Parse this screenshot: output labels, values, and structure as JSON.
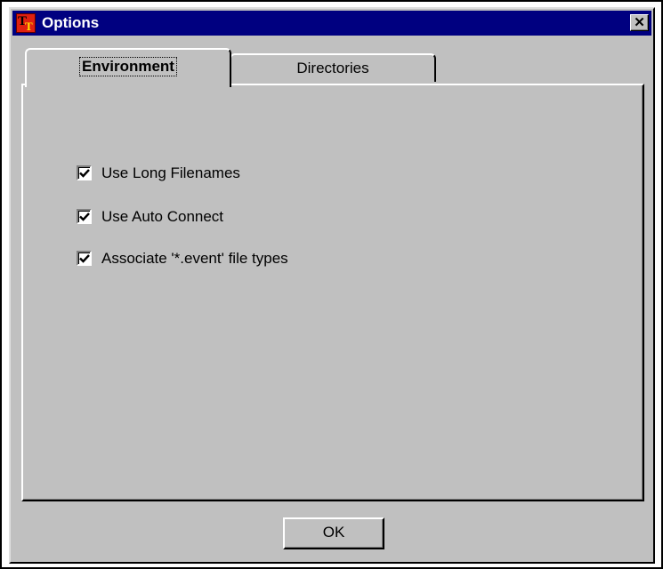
{
  "window": {
    "title": "Options",
    "icon": "tt-app-icon",
    "close_label": "✕",
    "colors": {
      "titlebar": "#000080",
      "face": "#c0c0c0",
      "icon_bg": "#e02010"
    }
  },
  "tabs": [
    {
      "label": "Environment",
      "active": true
    },
    {
      "label": "Directories",
      "active": false
    }
  ],
  "options": [
    {
      "label": "Use Long Filenames",
      "checked": true
    },
    {
      "label": "Use Auto Connect",
      "checked": true
    },
    {
      "label": "Associate '*.event' file types",
      "checked": true
    }
  ],
  "buttons": {
    "ok_label": "OK"
  }
}
